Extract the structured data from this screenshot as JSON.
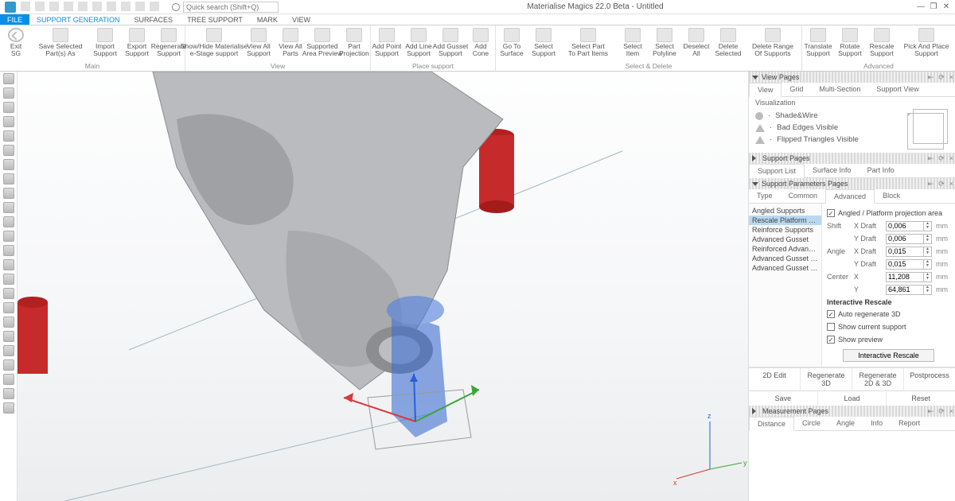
{
  "app": {
    "title": "Materialise Magics 22.0 Beta - Untitled"
  },
  "search": {
    "placeholder": "Quick search (Shift+Q)"
  },
  "tabs": {
    "file": "FILE",
    "items": [
      "SUPPORT GENERATION",
      "SURFACES",
      "TREE SUPPORT",
      "MARK",
      "VIEW"
    ],
    "activeIndex": 0
  },
  "ribbon": {
    "groups": [
      {
        "cap": "Main",
        "btns": [
          {
            "id": "exit-sg",
            "lbl": "Exit\nSG",
            "ico": "back"
          },
          {
            "id": "save-selected",
            "lbl": "Save Selected\nPart(s) As",
            "w": "wide"
          },
          {
            "id": "import-support",
            "lbl": "Import\nSupport"
          },
          {
            "id": "export-support",
            "lbl": "Export\nSupport"
          },
          {
            "id": "regenerate-support",
            "lbl": "Regenerate\nSupport"
          }
        ]
      },
      {
        "cap": "View",
        "btns": [
          {
            "id": "show-hide-estage",
            "lbl": "Show/Hide Materialise\ne-Stage support",
            "w": "wide"
          },
          {
            "id": "view-all-support",
            "lbl": "View All\nSupport"
          },
          {
            "id": "view-all-parts",
            "lbl": "View All\nParts"
          },
          {
            "id": "supported-area-preview",
            "lbl": "Supported\nArea Preview"
          },
          {
            "id": "part-projection",
            "lbl": "Part\nProjection"
          }
        ]
      },
      {
        "cap": "Place support",
        "btns": [
          {
            "id": "add-point-support",
            "lbl": "Add Point\nSupport"
          },
          {
            "id": "add-line-support",
            "lbl": "Add Line\nSupport"
          },
          {
            "id": "add-gusset-support",
            "lbl": "Add Gusset\nSupport"
          },
          {
            "id": "add-cone",
            "lbl": "Add\nCone",
            "w": "narrow"
          }
        ]
      },
      {
        "cap": "Select & Delete",
        "btns": [
          {
            "id": "goto-surface",
            "lbl": "Go To\nSurface"
          },
          {
            "id": "select-support",
            "lbl": "Select\nSupport"
          },
          {
            "id": "select-part-to-items",
            "lbl": "Select Part\nTo Part Items",
            "w": "wide"
          },
          {
            "id": "select-item",
            "lbl": "Select\nItem"
          },
          {
            "id": "select-polyline",
            "lbl": "Select\nPolyline"
          },
          {
            "id": "deselect-all",
            "lbl": "Deselect\nAll"
          },
          {
            "id": "delete-selected",
            "lbl": "Delete\nSelected"
          },
          {
            "id": "delete-range",
            "lbl": "Delete Range\nOf Supports",
            "w": "wide"
          }
        ]
      },
      {
        "cap": "Advanced",
        "btns": [
          {
            "id": "translate-support",
            "lbl": "Translate\nSupport"
          },
          {
            "id": "rotate-support",
            "lbl": "Rotate\nSupport"
          },
          {
            "id": "rescale-support",
            "lbl": "Rescale\nSupport"
          },
          {
            "id": "pick-place-support",
            "lbl": "Pick And Place\nSupport",
            "w": "wide"
          }
        ]
      }
    ]
  },
  "rightPanel": {
    "viewPages": {
      "title": "View Pages",
      "tabs": [
        "View",
        "Grid",
        "Multi-Section",
        "Support View"
      ],
      "section": "Visualization",
      "items": [
        "Shade&Wire",
        "Bad Edges Visible",
        "Flipped Triangles Visible"
      ]
    },
    "supportPages": {
      "title": "Support Pages",
      "tabs": [
        "Support List",
        "Surface Info",
        "Part Info"
      ]
    },
    "supportParams": {
      "title": "Support Parameters Pages",
      "tabs": [
        "Type",
        "Common",
        "Advanced",
        "Block"
      ],
      "activeTab": 2,
      "listItems": [
        "Angled Supports",
        "Rescale Platform Project…",
        "Reinforce Supports",
        "Advanced Gusset",
        "Reinforced Advanced G…",
        "Advanced Gusset Teeth",
        "Advanced Gusset Teeth …"
      ],
      "checkbox": {
        "checked": true,
        "label": "Angled / Platform projection area"
      },
      "fields": [
        {
          "k1": "Shift",
          "k2": "X Draft",
          "v": "0,006",
          "u": "mm"
        },
        {
          "k1": "",
          "k2": "Y Draft",
          "v": "0,006",
          "u": "mm"
        },
        {
          "k1": "Angle",
          "k2": "X Draft",
          "v": "0,015",
          "u": "mm"
        },
        {
          "k1": "",
          "k2": "Y Draft",
          "v": "0,015",
          "u": "mm"
        },
        {
          "k1": "Center",
          "k2": "X",
          "v": "11,208",
          "u": "mm"
        },
        {
          "k1": "",
          "k2": "Y",
          "v": "64,861",
          "u": "mm"
        }
      ],
      "rescaleHeader": "Interactive Rescale",
      "opts": [
        {
          "checked": true,
          "label": "Auto regenerate 3D"
        },
        {
          "checked": false,
          "label": "Show current support"
        },
        {
          "checked": true,
          "label": "Show preview"
        }
      ],
      "rescaleBtn": "Interactive Rescale",
      "actions": [
        "2D Edit",
        "Regenerate 3D",
        "Regenerate 2D & 3D",
        "Postprocess"
      ],
      "actions2": [
        "Save",
        "Load",
        "Reset"
      ]
    },
    "measurement": {
      "title": "Measurement Pages",
      "tabs": [
        "Distance",
        "Circle",
        "Angle",
        "Info",
        "Report"
      ]
    }
  },
  "axes": {
    "x": "x",
    "y": "y",
    "z": "z"
  }
}
